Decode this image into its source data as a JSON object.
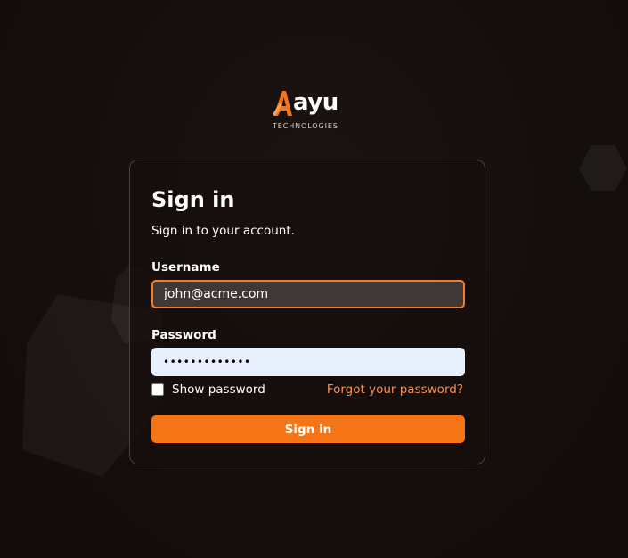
{
  "brand": {
    "name": "ayu",
    "tagline": "TECHNOLOGIES",
    "accent_color": "#f57415"
  },
  "login": {
    "title": "Sign in",
    "subtitle": "Sign in to your account.",
    "username_label": "Username",
    "username_value": "john@acme.com",
    "password_label": "Password",
    "password_value": "•••••••••••••",
    "show_password_label": "Show password",
    "show_password_checked": false,
    "forgot_link": "Forgot your password?",
    "submit_label": "Sign in"
  }
}
